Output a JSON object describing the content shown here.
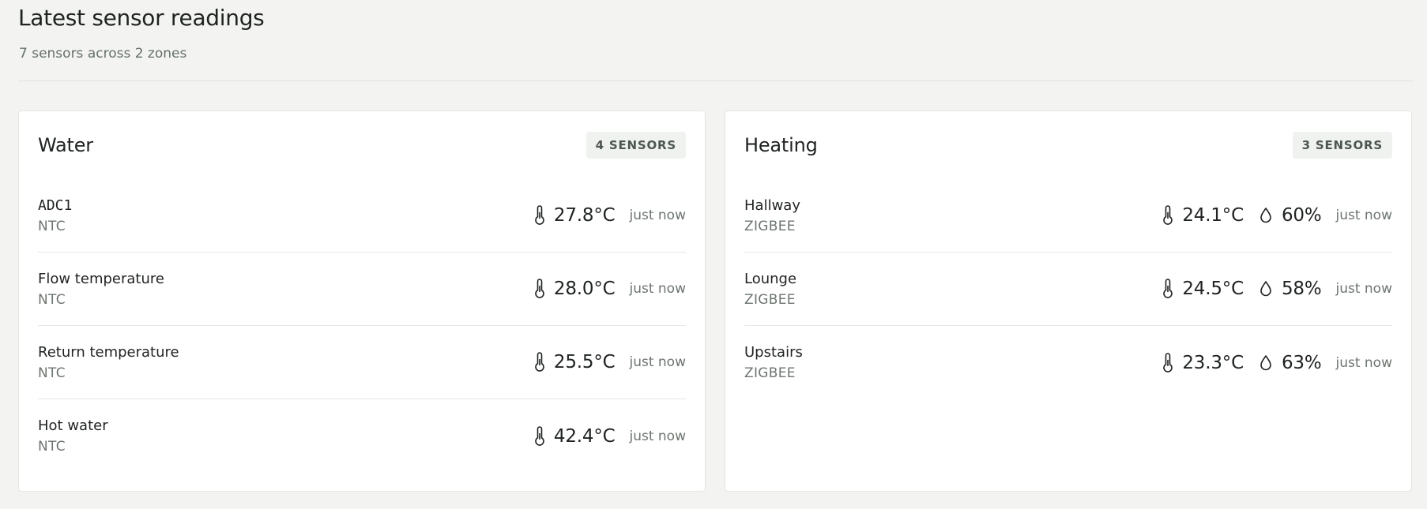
{
  "header": {
    "title": "Latest sensor readings",
    "subtitle": "7 sensors across 2 zones"
  },
  "zones": [
    {
      "name": "Water",
      "badge": "4 SENSORS",
      "sensors": [
        {
          "name": "ADC1",
          "type": "NTC",
          "temperature": "27.8°C",
          "updated": "just now"
        },
        {
          "name": "Flow temperature",
          "type": "NTC",
          "temperature": "28.0°C",
          "updated": "just now"
        },
        {
          "name": "Return temperature",
          "type": "NTC",
          "temperature": "25.5°C",
          "updated": "just now"
        },
        {
          "name": "Hot water",
          "type": "NTC",
          "temperature": "42.4°C",
          "updated": "just now"
        }
      ]
    },
    {
      "name": "Heating",
      "badge": "3 SENSORS",
      "sensors": [
        {
          "name": "Hallway",
          "type": "ZIGBEE",
          "temperature": "24.1°C",
          "humidity": "60%",
          "updated": "just now"
        },
        {
          "name": "Lounge",
          "type": "ZIGBEE",
          "temperature": "24.5°C",
          "humidity": "58%",
          "updated": "just now"
        },
        {
          "name": "Upstairs",
          "type": "ZIGBEE",
          "temperature": "23.3°C",
          "humidity": "63%",
          "updated": "just now"
        }
      ]
    }
  ],
  "icons": {
    "temperature": "thermometer-icon",
    "humidity": "droplet-icon"
  },
  "colors": {
    "background": "#f3f4f1",
    "card": "#ffffff",
    "text": "#1f2320",
    "muted": "#6d756f",
    "badge_bg": "#f0f2ef"
  }
}
